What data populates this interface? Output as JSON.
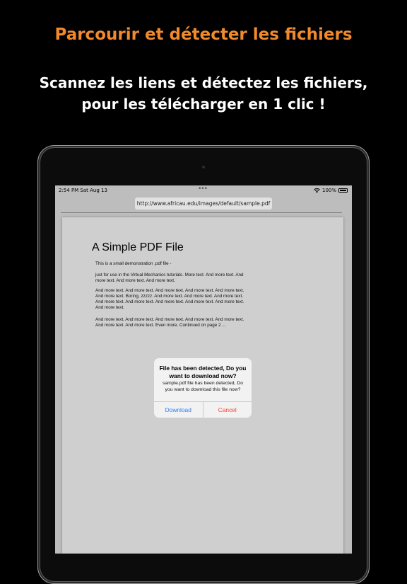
{
  "promo": {
    "headline": "Parcourir et détecter les fichiers",
    "subtitle_line1": "Scannez les liens et détectez les fichiers,",
    "subtitle_line2": "pour les télécharger en 1 clic !"
  },
  "status_bar": {
    "time_date": "2:54 PM   Sat Aug 13",
    "battery": "100%",
    "icons": [
      "more-dots-icon",
      "wifi-icon",
      "battery-icon"
    ]
  },
  "browser": {
    "url": "http://www.africau.edu/images/default/sample.pdf"
  },
  "pdf": {
    "title": "A Simple PDF File",
    "paragraphs": [
      "This is a small demonstration .pdf file -",
      "just for use in the Virtual Mechanics tutorials. More text. And more text. And more text. And more text. And more text.",
      "And more text. And more text. And more text. And more text. And more text. And more text. Boring, zzzzz. And more text. And more text. And more text. And more text. And more text. And more text. And more text. And more text. And more text.",
      "And more text. And more text. And more text. And more text. And more text. And more text. And more text. Even more. Continued on page 2 ..."
    ]
  },
  "alert": {
    "title": "File has been detected, Do you want to download now?",
    "message": "sample.pdf file has been detected, Do you want to download this file now?",
    "download_label": "Download",
    "cancel_label": "Cancel"
  },
  "colors": {
    "headline": "#f08a2c",
    "download": "#2f7cf6",
    "cancel": "#ff3b30"
  }
}
